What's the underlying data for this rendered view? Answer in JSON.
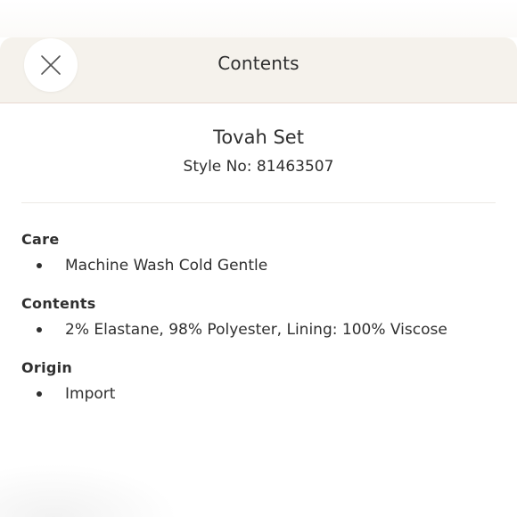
{
  "header": {
    "title": "Contents",
    "close_icon": "close-icon"
  },
  "product": {
    "name": "Tovah Set",
    "style_line": "Style No: 81463507"
  },
  "sections": {
    "care": {
      "title": "Care",
      "items": [
        "Machine Wash Cold Gentle"
      ]
    },
    "contents": {
      "title": "Contents",
      "items": [
        "2% Elastane, 98% Polyester, Lining: 100% Viscose"
      ]
    },
    "origin": {
      "title": "Origin",
      "items": [
        "Import"
      ]
    }
  },
  "colors": {
    "header_bg": "#f5f2ec",
    "text": "#2f2f2f",
    "divider": "#ece9e4"
  }
}
